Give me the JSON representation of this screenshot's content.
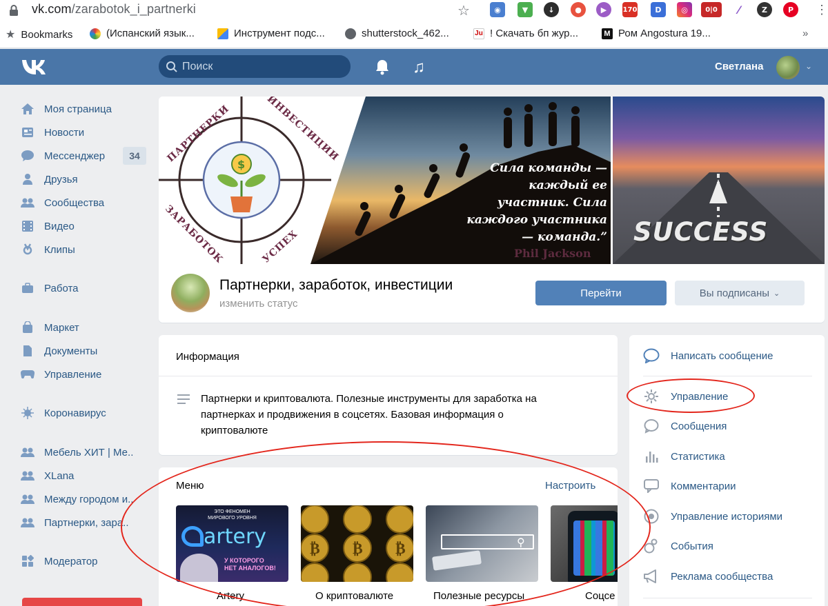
{
  "browser": {
    "url_host": "vk.com",
    "url_path": "/zarabotok_i_partnerki",
    "extensions": [
      "camera-ext",
      "download-ext",
      "arrow-ext",
      "chrome-ext",
      "play-ext",
      "170",
      "D",
      "instagram-ext",
      "0|0",
      "pen-ext",
      "Z",
      "pinterest-ext"
    ]
  },
  "bookmarks": {
    "root": "Bookmarks",
    "items": [
      "(Испанский язык...",
      "Инструмент подс...",
      "shutterstock_462...",
      "! Скачать бп жур...",
      "Ром Angostura 19..."
    ],
    "more": "»"
  },
  "header": {
    "search_placeholder": "Поиск",
    "user_name": "Светлана"
  },
  "sidebar": {
    "items": [
      {
        "label": "Моя страница",
        "icon": "home-icon"
      },
      {
        "label": "Новости",
        "icon": "news-icon"
      },
      {
        "label": "Мессенджер",
        "icon": "messenger-icon",
        "badge": "34"
      },
      {
        "label": "Друзья",
        "icon": "friends-icon"
      },
      {
        "label": "Сообщества",
        "icon": "communities-icon"
      },
      {
        "label": "Видео",
        "icon": "video-icon"
      },
      {
        "label": "Клипы",
        "icon": "clips-icon"
      },
      {
        "label": "Работа",
        "icon": "work-icon"
      },
      {
        "label": "Маркет",
        "icon": "market-icon"
      },
      {
        "label": "Документы",
        "icon": "documents-icon"
      },
      {
        "label": "Управление",
        "icon": "gamepad-icon"
      },
      {
        "label": "Коронавирус",
        "icon": "virus-icon"
      },
      {
        "label": "Мебель ХИТ | Ме..",
        "icon": "group-icon"
      },
      {
        "label": "XLana",
        "icon": "group-icon"
      },
      {
        "label": "Между городом и..",
        "icon": "group-icon"
      },
      {
        "label": "Партнерки, зара..",
        "icon": "group-icon"
      },
      {
        "label": "Модератор",
        "icon": "moderator-icon"
      }
    ]
  },
  "cover": {
    "ring_words": [
      "ПАРТНЕРКИ",
      "ИНВЕСТИЦИИ",
      "ЗАРАБОТОК",
      "УСПЕХ"
    ],
    "quote": "Сила команды — каждый ее участник. Сила каждого участника — команда.”",
    "quote_author": "Phil Jackson",
    "success_word": "SUCCESS"
  },
  "group": {
    "title": "Партнерки, заработок, инвестиции",
    "status": "изменить статус",
    "go_button": "Перейти",
    "subscribed_button": "Вы подписаны"
  },
  "info": {
    "heading": "Информация",
    "text": "Партнерки и криптовалюта. Полезные инструменты для заработка на партнерках и продвижения в соцсетях. Базовая информация о криптовалюте"
  },
  "menu": {
    "heading": "Меню",
    "configure": "Настроить",
    "tiles": [
      {
        "label": "Artery",
        "line1": "ЭТО ФЕНОМЕН",
        "line2": "МИРОВОГО УРОВНЯ",
        "brand": "artery",
        "line3": "У КОТОРОГО",
        "line4": "НЕТ АНАЛОГОВ!"
      },
      {
        "label": "О криптовалюте"
      },
      {
        "label": "Полезные ресурсы"
      },
      {
        "label": "Соцсе"
      }
    ]
  },
  "actions": {
    "items": [
      {
        "label": "Написать сообщение",
        "icon": "message-bubble-icon"
      },
      {
        "label": "Управление",
        "icon": "gear-icon"
      },
      {
        "label": "Сообщения",
        "icon": "chat-icon"
      },
      {
        "label": "Статистика",
        "icon": "stats-icon"
      },
      {
        "label": "Комментарии",
        "icon": "comment-icon"
      },
      {
        "label": "Управление историями",
        "icon": "stories-icon"
      },
      {
        "label": "События",
        "icon": "events-icon"
      },
      {
        "label": "Реклама сообщества",
        "icon": "megaphone-icon"
      }
    ]
  },
  "colors": {
    "vk_blue": "#4a76a8",
    "link_blue": "#2a5885",
    "annotation_red": "#e3261c"
  }
}
